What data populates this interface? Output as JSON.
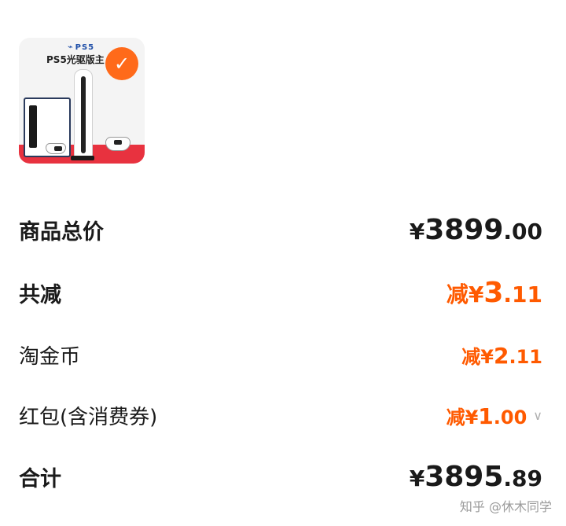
{
  "product": {
    "brand": "PS5",
    "caption": "PS5光驱版主",
    "check": "✓"
  },
  "summary": {
    "total_label": "商品总价",
    "total_currency": "¥",
    "total_int": "3899",
    "total_dec": ".00",
    "discount_label": "共减",
    "discount_prefix": "减¥",
    "discount_int": "3",
    "discount_dec": ".11",
    "coins_label": "淘金币",
    "coins_prefix": "减¥",
    "coins_int": "2",
    "coins_dec": ".11",
    "redpacket_label": "红包(含消费券)",
    "redpacket_prefix": "减¥",
    "redpacket_int": "1",
    "redpacket_dec": ".00",
    "grand_label": "合计",
    "grand_currency": "¥",
    "grand_int": "3895",
    "grand_dec": ".89"
  },
  "watermark": "知乎 @休木同学",
  "colors": {
    "accent": "#ff5a00",
    "badge": "#ff6a1a",
    "band": "#e8323f"
  }
}
